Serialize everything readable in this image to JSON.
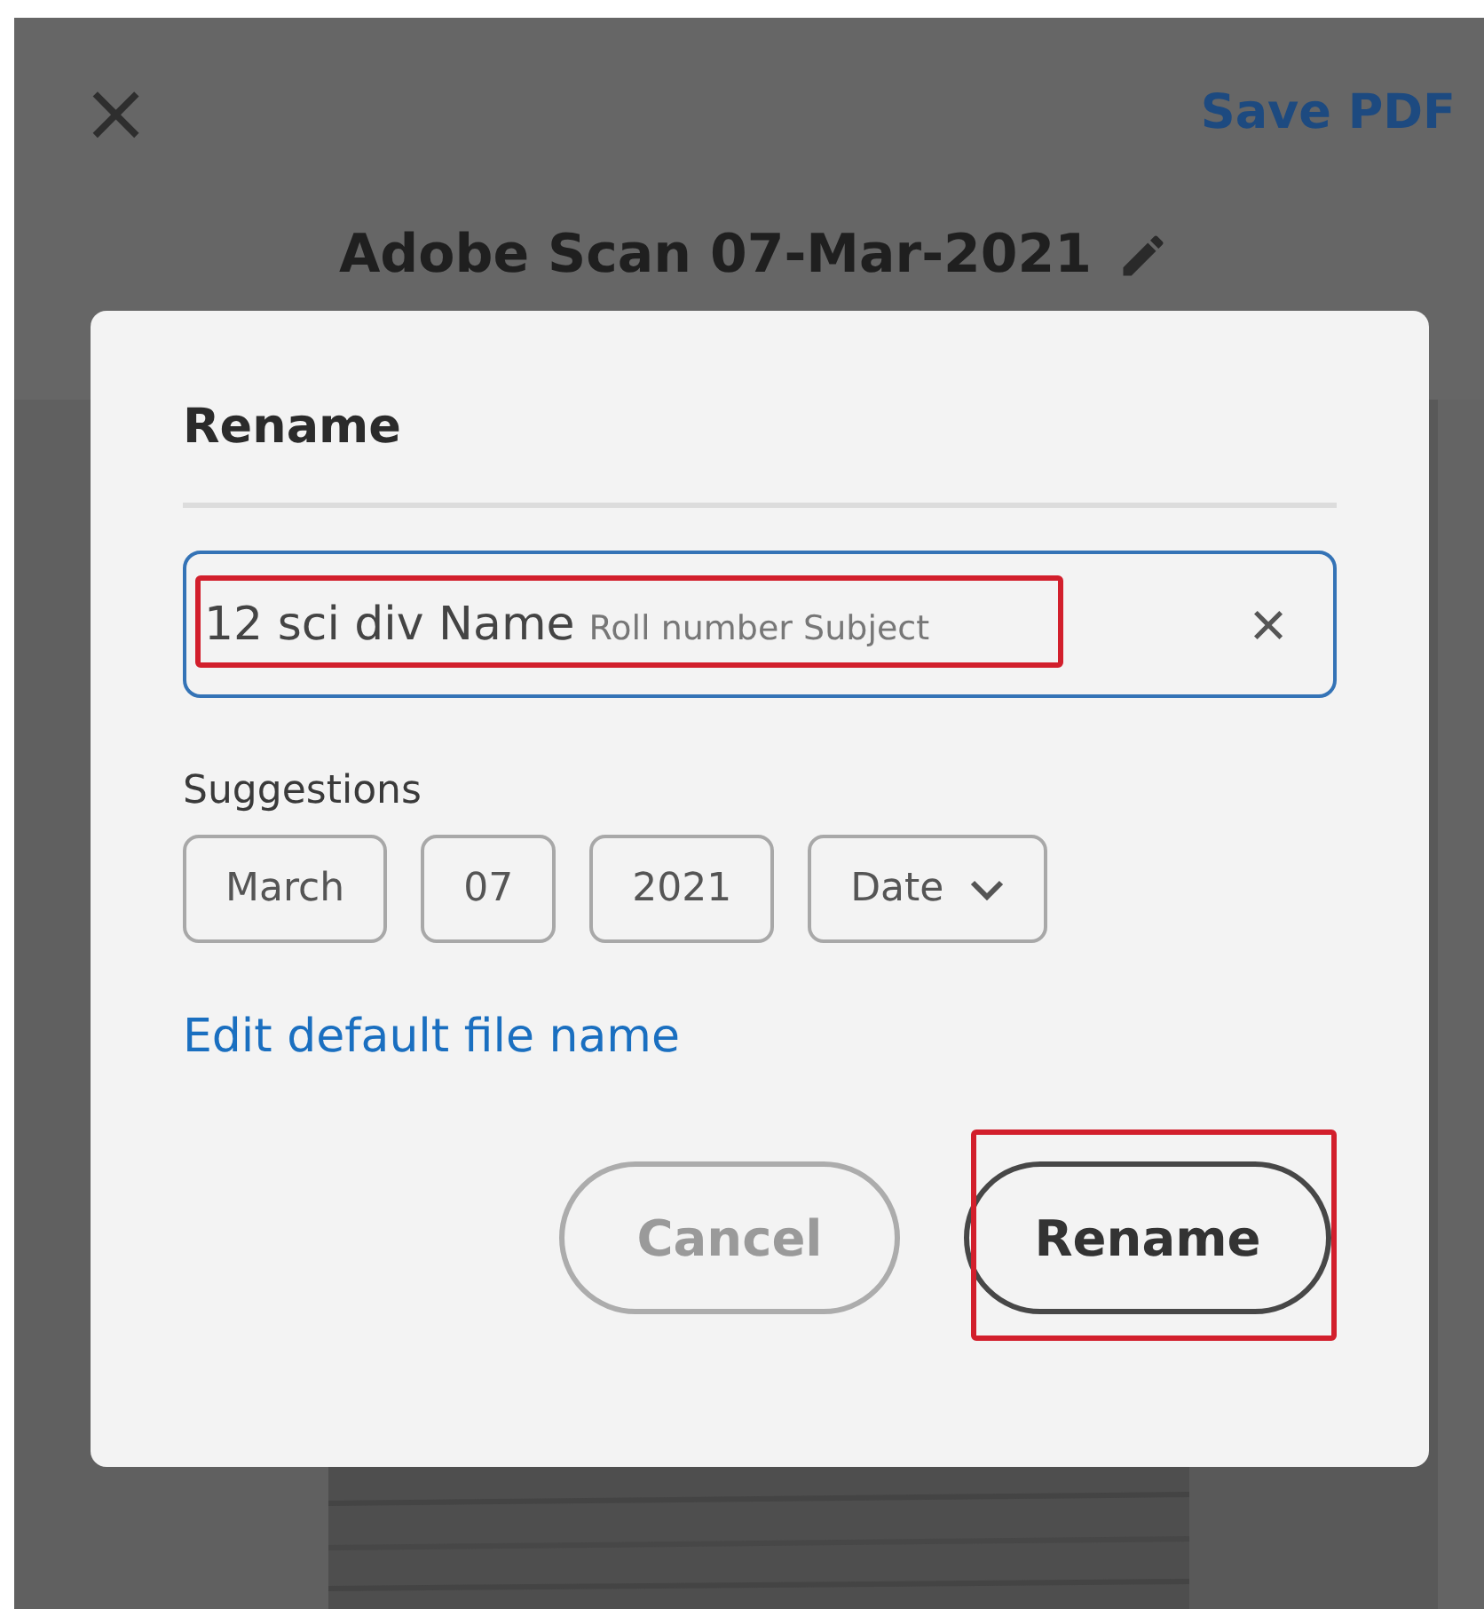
{
  "header": {
    "close_icon": "×",
    "save_button": "Save PDF",
    "document_title": "Adobe Scan 07-Mar-2021"
  },
  "dialog": {
    "title": "Rename",
    "field": {
      "value": "12 sci div Name",
      "suffix": "Roll number Subject",
      "clear": "×",
      "highlighted": true
    },
    "suggestions_label": "Suggestions",
    "suggestions": [
      {
        "label": "March",
        "kind": "chip"
      },
      {
        "label": "07",
        "kind": "chip"
      },
      {
        "label": "2021",
        "kind": "chip"
      },
      {
        "label": "Date",
        "kind": "dropdown"
      }
    ],
    "edit_link": "Edit default file name",
    "buttons": [
      {
        "label": "Cancel",
        "kind": "secondary",
        "highlighted": false
      },
      {
        "label": "Rename",
        "kind": "primary",
        "highlighted": true
      }
    ]
  }
}
